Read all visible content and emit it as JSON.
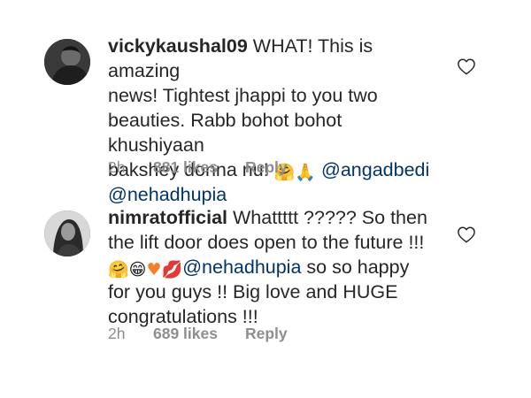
{
  "comments": [
    {
      "username": "vickykaushal09",
      "lines": [
        "WHAT! This is amazing",
        "news! Tightest jhappi to you two",
        "beauties. Rabb bohot bohot khushiyaan",
        "bakshey donna nu!"
      ],
      "emojis_1": [
        "hug-emoji",
        "folded-hands-emoji"
      ],
      "mentions": [
        "@angadbedi",
        "@nehadhupia"
      ],
      "time": "2h",
      "likes": "881 likes",
      "reply": "Reply"
    },
    {
      "username": "nimratofficial",
      "lines": [
        "Whattttt ????? So then",
        "the lift door does open to the future !!!",
        "so so happy",
        "for you guys !! Big love and HUGE",
        "congratulations !!!"
      ],
      "emojis_1": [
        "hug-emoji",
        "grinning-emoji",
        "orange-heart-emoji",
        "kiss-mark-emoji"
      ],
      "mentions": [
        "@nehadhupia"
      ],
      "time": "2h",
      "likes": "689 likes",
      "reply": "Reply"
    }
  ]
}
